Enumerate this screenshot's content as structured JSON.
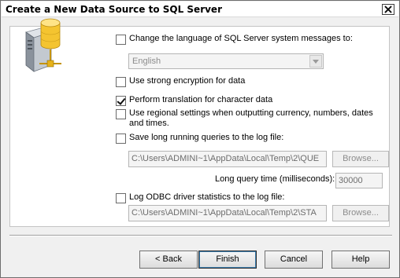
{
  "window": {
    "title": "Create a New Data Source to SQL Server"
  },
  "options": {
    "change_language": {
      "label": "Change the language of SQL Server system messages to:",
      "checked": false
    },
    "language_select": {
      "value": "English"
    },
    "strong_encryption": {
      "label": "Use strong encryption for data",
      "checked": false
    },
    "translation": {
      "label": "Perform translation for character data",
      "checked": true
    },
    "regional": {
      "label": "Use regional settings when outputting currency, numbers, dates and times.",
      "checked": false
    },
    "long_queries": {
      "label": "Save long running queries to the log file:",
      "checked": false
    },
    "long_query_path": "C:\\Users\\ADMINI~1\\AppData\\Local\\Temp\\2\\QUE",
    "long_query_browse": "Browse...",
    "long_query_time_label": "Long query time (milliseconds):",
    "long_query_time": "30000",
    "odbc_stats": {
      "label": "Log ODBC driver statistics to the log file:",
      "checked": false
    },
    "odbc_stats_path": "C:\\Users\\ADMINI~1\\AppData\\Local\\Temp\\2\\STA",
    "odbc_stats_browse": "Browse..."
  },
  "buttons": {
    "back": "< Back",
    "finish": "Finish",
    "cancel": "Cancel",
    "help": "Help"
  },
  "icons": {
    "close": "close-icon",
    "database": "database-server-icon",
    "dropdown": "chevron-down-icon"
  }
}
